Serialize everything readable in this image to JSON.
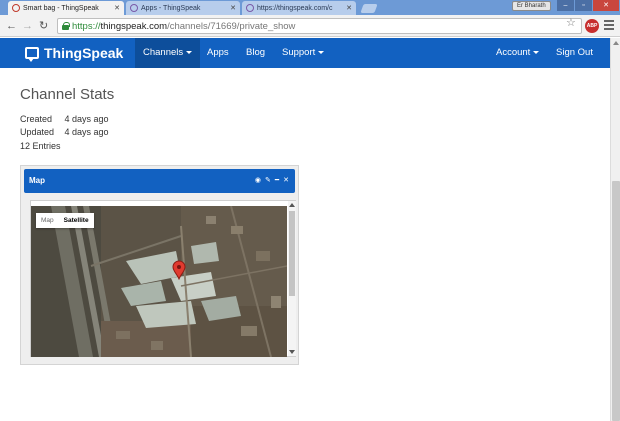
{
  "browser": {
    "tabs": [
      {
        "title": "Smart bag - ThingSpeak",
        "active": true
      },
      {
        "title": "Apps - ThingSpeak",
        "active": false
      },
      {
        "title": "https://thingspeak.com/c",
        "active": false
      }
    ],
    "user_badge": "Er Bharath",
    "url": {
      "scheme": "https://",
      "host": "thingspeak.com",
      "path": "/channels/71669/private_show"
    },
    "window_controls": {
      "minimize": "–",
      "maximize": "▫",
      "close": "✕"
    },
    "adblock_label": "ABP"
  },
  "navbar": {
    "brand": "ThingSpeak",
    "items": [
      {
        "label": "Channels",
        "has_caret": true,
        "active": true
      },
      {
        "label": "Apps",
        "has_caret": false,
        "active": false
      },
      {
        "label": "Blog",
        "has_caret": false,
        "active": false
      },
      {
        "label": "Support",
        "has_caret": true,
        "active": false
      }
    ],
    "right_items": [
      {
        "label": "Account",
        "has_caret": true
      },
      {
        "label": "Sign Out",
        "has_caret": false
      }
    ],
    "color": "#1261c1"
  },
  "channel_stats": {
    "title": "Channel Stats",
    "created_label": "Created",
    "created_value": "4 days ago",
    "updated_label": "Updated",
    "updated_value": "4 days ago",
    "entries": "12 Entries"
  },
  "map_widget": {
    "title": "Map",
    "tool_icons": [
      "comment-icon",
      "edit-icon",
      "minimize-icon",
      "close-icon"
    ],
    "map_type_options": [
      "Map",
      "Satellite"
    ],
    "selected_map_type": "Satellite"
  }
}
